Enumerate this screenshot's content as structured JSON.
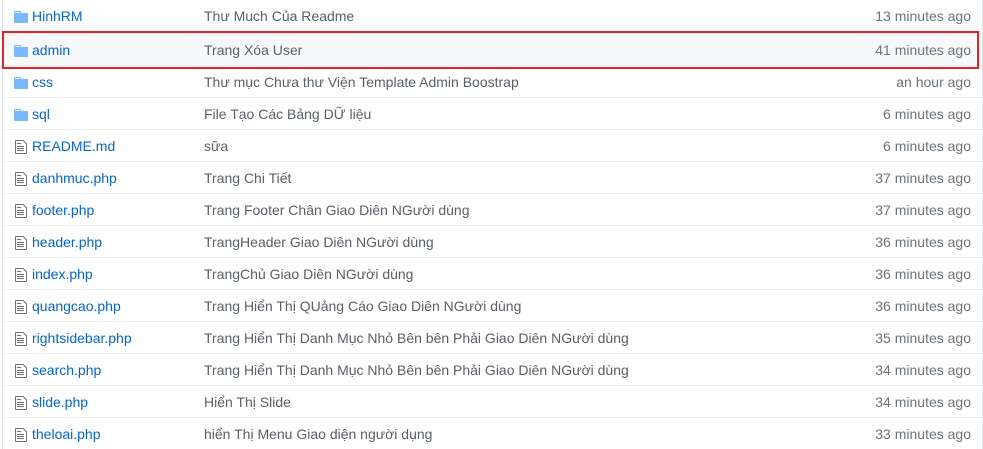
{
  "files": [
    {
      "type": "folder",
      "name": "HinhRM",
      "message": "Thư Much Của Readme",
      "age": "13 minutes ago"
    },
    {
      "type": "folder",
      "name": "admin",
      "message": "Trang Xóa User",
      "age": "41 minutes ago"
    },
    {
      "type": "folder",
      "name": "css",
      "message": "Thư mục Chưa thư Viện Template Admin Boostrap",
      "age": "an hour ago"
    },
    {
      "type": "folder",
      "name": "sql",
      "message": "File Tạo Các Bảng DỮ liệu",
      "age": "6 minutes ago"
    },
    {
      "type": "file",
      "name": "README.md",
      "message": "sữa",
      "age": "6 minutes ago"
    },
    {
      "type": "file",
      "name": "danhmuc.php",
      "message": "Trang Chi Tiết",
      "age": "37 minutes ago"
    },
    {
      "type": "file",
      "name": "footer.php",
      "message": "Trang Footer Chân Giao Diên NGười dùng",
      "age": "37 minutes ago"
    },
    {
      "type": "file",
      "name": "header.php",
      "message": "TrangHeader Giao Diên NGười dùng",
      "age": "36 minutes ago"
    },
    {
      "type": "file",
      "name": "index.php",
      "message": "TrangChủ Giao Diên NGười dùng",
      "age": "36 minutes ago"
    },
    {
      "type": "file",
      "name": "quangcao.php",
      "message": "Trang Hiển Thị QUảng Cáo Giao Diên NGười dùng",
      "age": "36 minutes ago"
    },
    {
      "type": "file",
      "name": "rightsidebar.php",
      "message": "Trang Hiển Thị Danh Mục Nhỏ Bên bên Phải Giao Diên NGười dùng",
      "age": "35 minutes ago"
    },
    {
      "type": "file",
      "name": "search.php",
      "message": "Trang Hiển Thị Danh Mục Nhỏ Bên bên Phải Giao Diên NGười dùng",
      "age": "34 minutes ago"
    },
    {
      "type": "file",
      "name": "slide.php",
      "message": "Hiển Thị Slide",
      "age": "34 minutes ago"
    },
    {
      "type": "file",
      "name": "theloai.php",
      "message": "hiển Thị Menu Giao diện người dụng",
      "age": "33 minutes ago"
    }
  ],
  "highlighted_index": 1,
  "colors": {
    "link": "#0366d6",
    "folder_icon": "#79b8ff",
    "highlight_border": "#e0242a",
    "row_hover": "#f6f8fa"
  }
}
